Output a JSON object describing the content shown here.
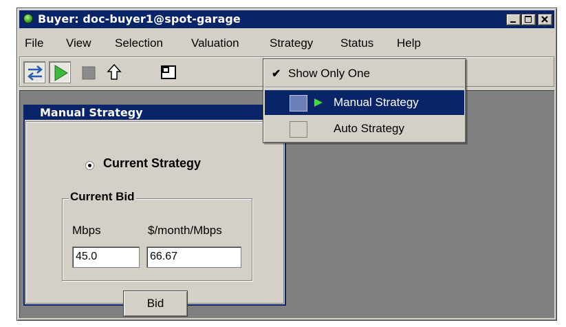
{
  "window": {
    "title": "Buyer: doc-buyer1@spot-garage"
  },
  "menubar": {
    "items": [
      "File",
      "View",
      "Selection",
      "Valuation",
      "Strategy",
      "Status",
      "Help"
    ]
  },
  "toolbar": {
    "icons": [
      "swap-arrows-icon",
      "play-icon",
      "stop-icon",
      "up-arrow-icon",
      "window-icon"
    ]
  },
  "strategy_menu": {
    "show_only_one": "Show Only One",
    "show_only_one_checked": true,
    "items": [
      {
        "label": "Manual Strategy",
        "selected": true
      },
      {
        "label": "Auto Strategy",
        "selected": false
      }
    ]
  },
  "internal_frame": {
    "title": "Manual Strategy",
    "radio_label": "Current Strategy",
    "radio_checked": true,
    "group_title": "Current Bid",
    "mbps_label": "Mbps",
    "price_label": "$/month/Mbps",
    "mbps_value": "45.0",
    "price_value": "66.67",
    "bid_button": "Bid"
  },
  "colors": {
    "title_bar": "#0a246a",
    "face": "#d4d0c8",
    "desktop": "#808080",
    "play_green": "#3cb83c"
  }
}
